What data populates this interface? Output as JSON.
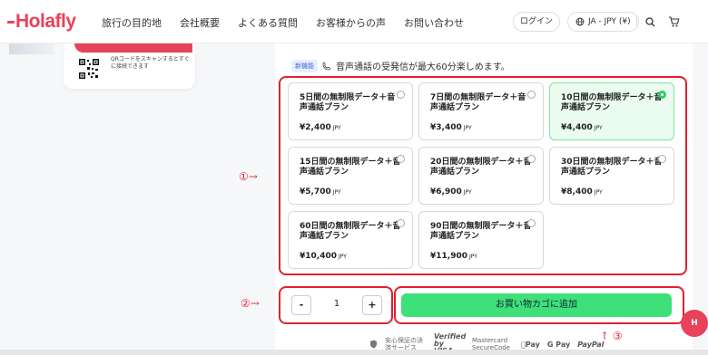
{
  "header": {
    "logo": "Holafly",
    "nav": [
      "旅行の目的地",
      "会社概要",
      "よくある質問",
      "お客様からの声",
      "お問い合わせ"
    ],
    "login": "ログイン",
    "language": "JA - JPY (¥)"
  },
  "promo": {
    "qr_text": "QRコードをスキャンするとすぐに接続できます"
  },
  "notice": {
    "badge": "新機能",
    "text": "音声通話の受発信が最大60分楽しめます。"
  },
  "plans": [
    {
      "name": "5日間の無制限データ＋音声通話プラン",
      "price": "¥2,400",
      "currency": "JPY",
      "selected": false
    },
    {
      "name": "7日間の無制限データ＋音声通話プラン",
      "price": "¥3,400",
      "currency": "JPY",
      "selected": false
    },
    {
      "name": "10日間の無制限データ＋音声通話プラン",
      "price": "¥4,400",
      "currency": "JPY",
      "selected": true
    },
    {
      "name": "15日間の無制限データ＋音声通話プラン",
      "price": "¥5,700",
      "currency": "JPY",
      "selected": false
    },
    {
      "name": "20日間の無制限データ＋音声通話プラン",
      "price": "¥6,900",
      "currency": "JPY",
      "selected": false
    },
    {
      "name": "30日間の無制限データ＋音声通話プラン",
      "price": "¥8,400",
      "currency": "JPY",
      "selected": false
    },
    {
      "name": "60日間の無制限データ＋音声通話プラン",
      "price": "¥10,400",
      "currency": "JPY",
      "selected": false
    },
    {
      "name": "90日間の無制限データ＋音声通話プラン",
      "price": "¥11,900",
      "currency": "JPY",
      "selected": false
    }
  ],
  "quantity": {
    "minus": "-",
    "value": "1",
    "plus": "+"
  },
  "cart": {
    "label": "お買い物カゴに追加"
  },
  "payments": {
    "secure": "安心保証の決済サービス",
    "verified": "Verified by VISA",
    "mastercard": "Mastercard SecureCode",
    "applepay": "Pay",
    "gpay": "G Pay",
    "paypal": "PayPal"
  },
  "annotations": {
    "a1": "①→",
    "a2": "②→",
    "a3": "↑ ③"
  },
  "fab": "H",
  "colors": {
    "brand": "#e8425a",
    "cart_button": "#3ee07a",
    "annotation": "#e2202f",
    "selected_plan_bg": "#eafcef"
  }
}
